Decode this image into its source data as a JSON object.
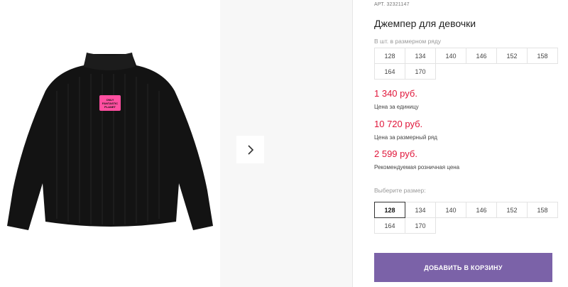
{
  "product": {
    "article_prefix": "АРТ.",
    "article_number": "32321147",
    "title": "Джемпер для девочки",
    "patch_text": "ONLY FANTASTIC PLANET"
  },
  "row_sizes": {
    "caption": "В шт. в размерном ряду",
    "sizes": [
      "128",
      "134",
      "140",
      "146",
      "152",
      "158",
      "164",
      "170"
    ]
  },
  "prices": [
    {
      "value": "1 340 руб.",
      "label": "Цена за единицу"
    },
    {
      "value": "10 720 руб.",
      "label": "Цена за размерный ряд"
    },
    {
      "value": "2 599 руб.",
      "label": "Рекомендуемая розничная цена"
    }
  ],
  "size_picker": {
    "caption": "Выберите размер:",
    "selected": "128",
    "sizes": [
      "128",
      "134",
      "140",
      "146",
      "152",
      "158",
      "164",
      "170"
    ]
  },
  "cart_button": {
    "label": "ДОБАВИТЬ В КОРЗИНУ"
  },
  "colors": {
    "price": "#e0163a",
    "cart_button": "#7b62a8",
    "sweater": "#111111",
    "patch": "#ff4fa0"
  },
  "icons": {
    "next": "chevron-right-icon"
  }
}
